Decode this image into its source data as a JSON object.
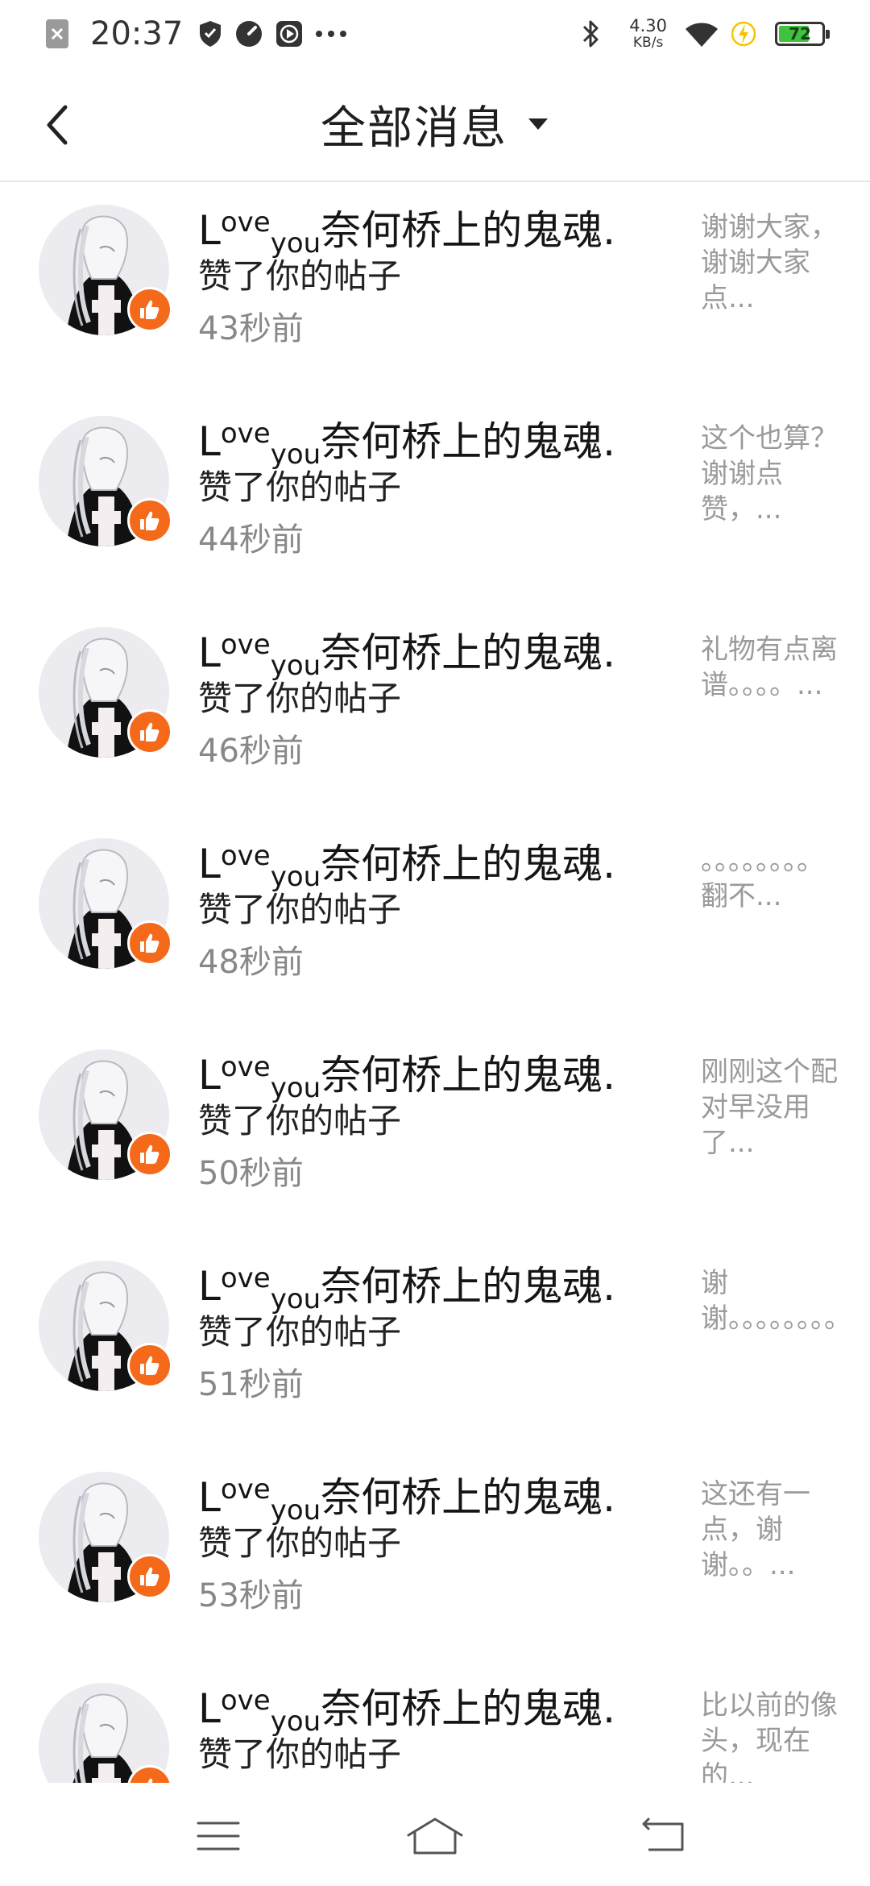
{
  "status_bar": {
    "time": "20:37",
    "net_speed_value": "4.30",
    "net_speed_unit": "KB/s",
    "battery_level": "72"
  },
  "header": {
    "title": "全部消息"
  },
  "messages": [
    {
      "name_l": "L",
      "name_ove": "ove",
      "name_you": "you",
      "name_rest": "奈何桥上的鬼魂.",
      "action": "赞了你的帖子",
      "time": "43秒前",
      "preview": "谢谢大家，谢谢大家点..."
    },
    {
      "name_l": "L",
      "name_ove": "ove",
      "name_you": "you",
      "name_rest": "奈何桥上的鬼魂.",
      "action": "赞了你的帖子",
      "time": "44秒前",
      "preview": "这个也算？谢谢点赞，..."
    },
    {
      "name_l": "L",
      "name_ove": "ove",
      "name_you": "you",
      "name_rest": "奈何桥上的鬼魂.",
      "action": "赞了你的帖子",
      "time": "46秒前",
      "preview": "礼物有点离谱。。。。..."
    },
    {
      "name_l": "L",
      "name_ove": "ove",
      "name_you": "you",
      "name_rest": "奈何桥上的鬼魂.",
      "action": "赞了你的帖子",
      "time": "48秒前",
      "preview": "。。。。。。。。翻不..."
    },
    {
      "name_l": "L",
      "name_ove": "ove",
      "name_you": "you",
      "name_rest": "奈何桥上的鬼魂.",
      "action": "赞了你的帖子",
      "time": "50秒前",
      "preview": "刚刚这个配对早没用了..."
    },
    {
      "name_l": "L",
      "name_ove": "ove",
      "name_you": "you",
      "name_rest": "奈何桥上的鬼魂.",
      "action": "赞了你的帖子",
      "time": "51秒前",
      "preview": "谢谢。。。。。。。。..."
    },
    {
      "name_l": "L",
      "name_ove": "ove",
      "name_you": "you",
      "name_rest": "奈何桥上的鬼魂.",
      "action": "赞了你的帖子",
      "time": "53秒前",
      "preview": "这还有一点，谢谢。。..."
    },
    {
      "name_l": "L",
      "name_ove": "ove",
      "name_you": "you",
      "name_rest": "奈何桥上的鬼魂.",
      "action": "赞了你的帖子",
      "time": "",
      "preview": "比以前的像头，现在的..."
    }
  ],
  "colors": {
    "like_badge": "#f56a1a",
    "battery_fill": "#3fc33f",
    "preview_text": "#9a9a9a",
    "time_text": "#888888"
  },
  "icons": {
    "status_left": [
      "close-notification-icon",
      "shield-icon",
      "speedometer-icon",
      "play-icon",
      "more-dots-icon"
    ],
    "status_right": [
      "bluetooth-icon",
      "wifi-icon",
      "charging-bolt-icon",
      "battery-icon"
    ],
    "header": [
      "back-arrow-icon",
      "dropdown-caret-icon"
    ],
    "badge": "thumbs-up-icon",
    "nav": [
      "menu-lines-icon",
      "home-icon",
      "back-nav-icon"
    ]
  }
}
